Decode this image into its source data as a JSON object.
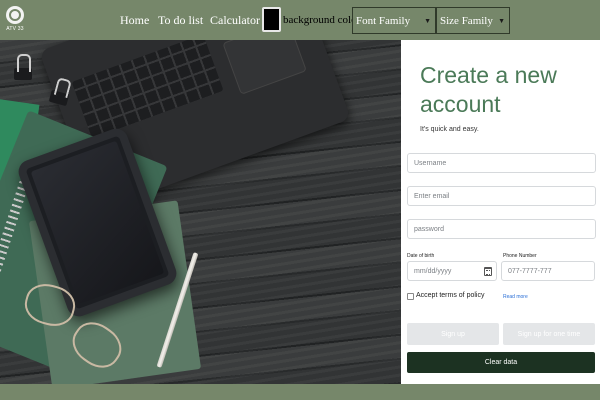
{
  "logo": {
    "text": "ATV 33",
    "icon": "logo-icon"
  },
  "nav": {
    "links": [
      "Home",
      "To do list",
      "Calculator"
    ],
    "background_color_label": "background color",
    "background_color_value": "#000000",
    "font_family_select": "Font Family",
    "size_family_select": "Size Family"
  },
  "form": {
    "title": "Create a new account",
    "subtitle": "It's quick and easy.",
    "username_placeholder": "Username",
    "email_placeholder": "Enter email",
    "password_placeholder": "password",
    "dob_label": "Date of birth",
    "dob_placeholder": "mm/dd/yyyy",
    "phone_label": "Phone Number",
    "phone_placeholder": "077-7777-777",
    "terms_label": "Accept terms of policy",
    "read_more": "Read more",
    "sign_up": "Sign up",
    "sign_up_one_time": "Sign up for one time",
    "clear_data": "Clear data"
  },
  "colors": {
    "nav_bg": "#76876a",
    "title_green": "#4b7a58",
    "clear_button": "#1c3222",
    "disabled_button": "#e4e6e8"
  }
}
